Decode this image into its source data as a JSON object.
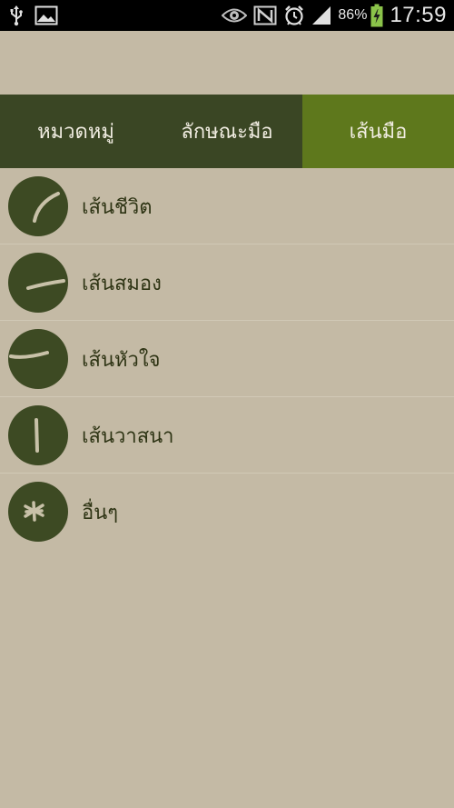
{
  "status_bar": {
    "battery_percent": "86%",
    "clock": "17:59",
    "icons": [
      "usb-icon",
      "gallery-icon",
      "eye-icon",
      "nfc-icon",
      "alarm-icon",
      "signal-icon",
      "battery-charging-icon"
    ]
  },
  "tabs": [
    {
      "label": "หมวดหมู่",
      "active": false
    },
    {
      "label": "ลักษณะมือ",
      "active": false
    },
    {
      "label": "เส้นมือ",
      "active": true
    }
  ],
  "list": [
    {
      "label": "เส้นชีวิต",
      "icon": "life-line-icon"
    },
    {
      "label": "เส้นสมอง",
      "icon": "head-line-icon"
    },
    {
      "label": "เส้นหัวใจ",
      "icon": "heart-line-icon"
    },
    {
      "label": "เส้นวาสนา",
      "icon": "fate-line-icon"
    },
    {
      "label": "อื่นๆ",
      "icon": "asterisk-icon"
    }
  ],
  "colors": {
    "background": "#c4baa5",
    "tab_bar": "#3a4624",
    "tab_active": "#5e781c",
    "icon_circle": "#3d4a23",
    "icon_stroke": "#c8c1a8",
    "label_text": "#2e3414"
  }
}
